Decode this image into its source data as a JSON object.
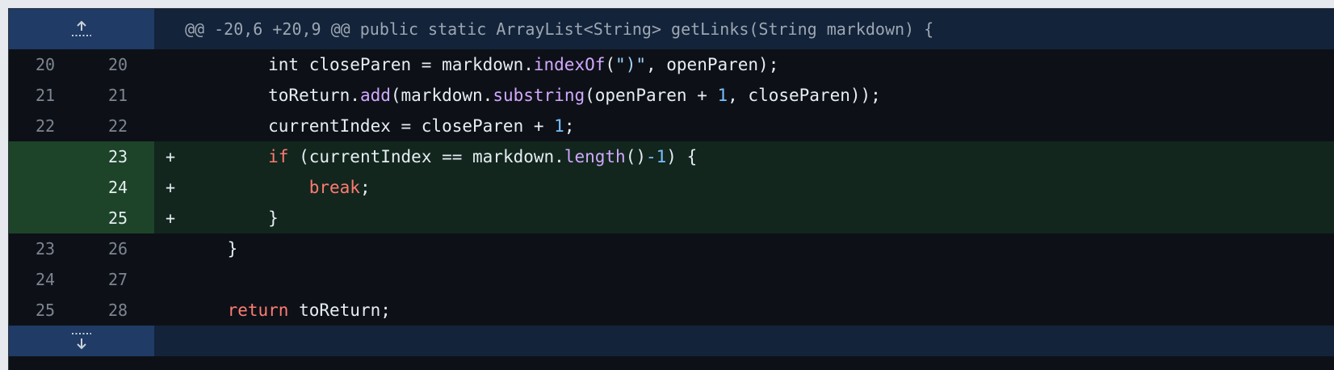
{
  "hunk_header": "@@ -20,6 +20,9 @@ public static ArrayList<String> getLinks(String markdown) {",
  "lines": [
    {
      "old": "20",
      "new": "20",
      "marker": "",
      "added": false,
      "tokens": [
        {
          "t": "        int closeParen = markdown.",
          "c": ""
        },
        {
          "t": "indexOf",
          "c": "fn"
        },
        {
          "t": "(",
          "c": ""
        },
        {
          "t": "\")\"",
          "c": "str"
        },
        {
          "t": ", openParen);",
          "c": ""
        }
      ]
    },
    {
      "old": "21",
      "new": "21",
      "marker": "",
      "added": false,
      "tokens": [
        {
          "t": "        toReturn.",
          "c": ""
        },
        {
          "t": "add",
          "c": "fn"
        },
        {
          "t": "(markdown.",
          "c": ""
        },
        {
          "t": "substring",
          "c": "fn"
        },
        {
          "t": "(openParen + ",
          "c": ""
        },
        {
          "t": "1",
          "c": "numlit"
        },
        {
          "t": ", closeParen));",
          "c": ""
        }
      ]
    },
    {
      "old": "22",
      "new": "22",
      "marker": "",
      "added": false,
      "tokens": [
        {
          "t": "        currentIndex = closeParen + ",
          "c": ""
        },
        {
          "t": "1",
          "c": "numlit"
        },
        {
          "t": ";",
          "c": ""
        }
      ]
    },
    {
      "old": "",
      "new": "23",
      "marker": "+",
      "added": true,
      "tokens": [
        {
          "t": "        ",
          "c": ""
        },
        {
          "t": "if",
          "c": "kw"
        },
        {
          "t": " (currentIndex == markdown.",
          "c": ""
        },
        {
          "t": "length",
          "c": "fn"
        },
        {
          "t": "()",
          "c": ""
        },
        {
          "t": "-1",
          "c": "numlit"
        },
        {
          "t": ") {",
          "c": ""
        }
      ]
    },
    {
      "old": "",
      "new": "24",
      "marker": "+",
      "added": true,
      "tokens": [
        {
          "t": "            ",
          "c": ""
        },
        {
          "t": "break",
          "c": "kw"
        },
        {
          "t": ";",
          "c": ""
        }
      ]
    },
    {
      "old": "",
      "new": "25",
      "marker": "+",
      "added": true,
      "tokens": [
        {
          "t": "        }",
          "c": ""
        }
      ]
    },
    {
      "old": "23",
      "new": "26",
      "marker": "",
      "added": false,
      "tokens": [
        {
          "t": "    }",
          "c": ""
        }
      ]
    },
    {
      "old": "24",
      "new": "27",
      "marker": "",
      "added": false,
      "tokens": [
        {
          "t": "",
          "c": ""
        }
      ]
    },
    {
      "old": "25",
      "new": "28",
      "marker": "",
      "added": false,
      "tokens": [
        {
          "t": "    ",
          "c": ""
        },
        {
          "t": "return",
          "c": "kw"
        },
        {
          "t": " toReturn;",
          "c": ""
        }
      ]
    }
  ],
  "icons": {
    "expand_up": "expand-up-icon",
    "expand_down": "expand-down-icon"
  },
  "colors": {
    "background": "#0d1117",
    "added_gutter": "#1d4428",
    "added_line": "#12261e",
    "hunk_gutter": "#1f3b66",
    "hunk_line": "#13233a",
    "keyword": "#ff7b72",
    "function": "#d2a8ff",
    "string": "#a5d6ff",
    "number": "#79c0ff"
  }
}
